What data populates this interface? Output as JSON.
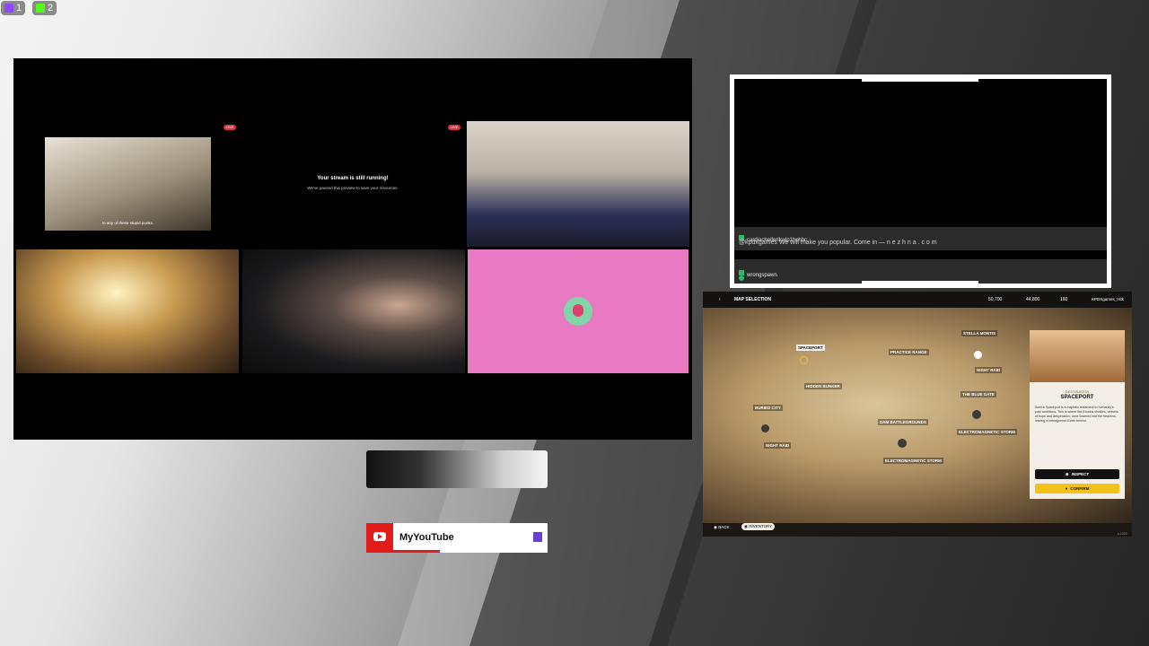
{
  "badges": [
    {
      "icon": "twitch-icon",
      "count": "1",
      "color": "#9146ff"
    },
    {
      "icon": "kick-icon",
      "count": "2",
      "color": "#53fc18"
    }
  ],
  "call": {
    "live_label": "LIVE",
    "paused_title": "Your stream is still running!",
    "paused_subtitle": "We've paused this preview to save your resources.",
    "anime_subtitle": "to any of these stupid punks."
  },
  "chat": {
    "messages": [
      {
        "user": "cardiacheiferllcxlp1hchbc",
        "text": "@kpdxgames We will make you popular. Come in — n e z h n a . c o m"
      },
      {
        "user": "wrongspawn",
        "text": ""
      }
    ]
  },
  "game": {
    "screen_title": "MAP SELECTION",
    "currency": [
      "50,700",
      "44,800",
      "160"
    ],
    "player": "KPDXgames_Hitk",
    "locations": [
      "SPACEPORT",
      "PRACTICE RANGE",
      "STELLA MONTIS",
      "NIGHT RAID",
      "HIDDEN BUNKER",
      "THE BLUE GATE",
      "BURIED CITY",
      "NIGHT RAID",
      "DAM BATTLEGROUNDS",
      "ELECTROMAGNETIC STORM",
      "ELECTROMAGNETIC STORM"
    ],
    "card": {
      "eyebrow": "DESTINATION",
      "name": "SPACEPORT",
      "description": "Acerra Spaceport is a majestic testament to humanity's past ambitions. This is where the Exodus shuttles, vessels of hope and desperation, once towered into the heavens, leaving a beleaguered Earth behind.",
      "inspect_label": "INSPECT",
      "confirm_label": "CONFIRM"
    },
    "footer": {
      "back_label": "BACK",
      "inventory_label": "INVENTORY",
      "version": "p.1020"
    }
  },
  "youtube": {
    "label": "MyYouTube"
  }
}
